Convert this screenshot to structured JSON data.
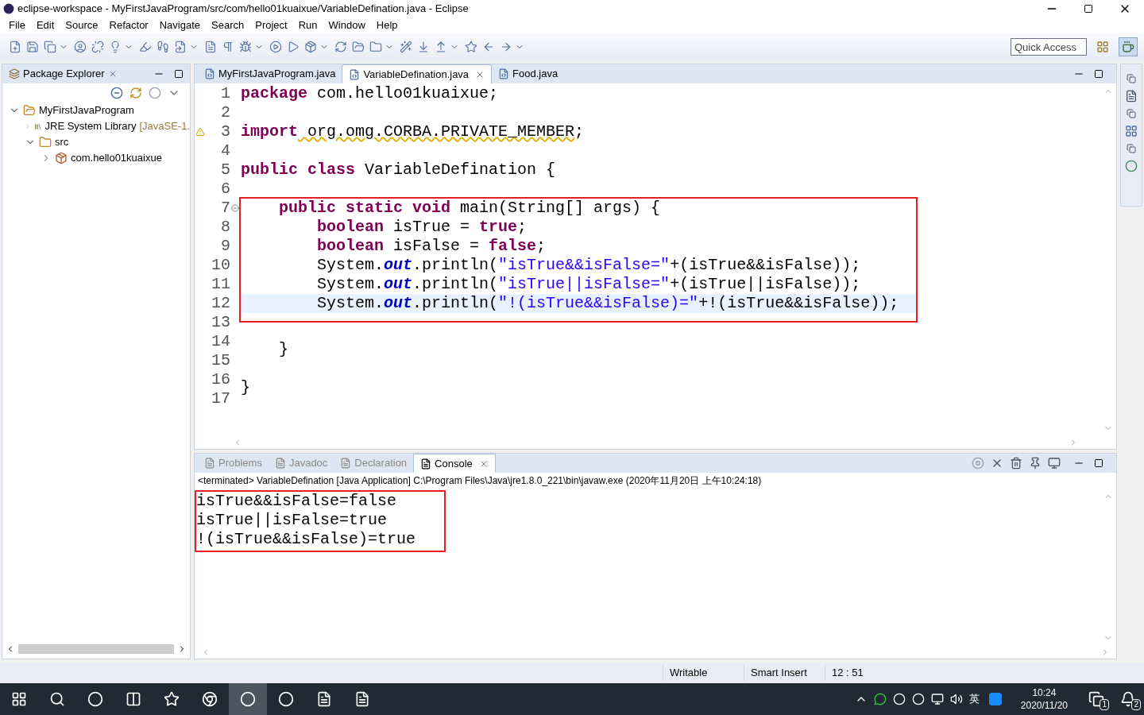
{
  "window": {
    "title": "eclipse-workspace - MyFirstJavaProgram/src/com/hello01kuaixue/VariableDefination.java - Eclipse"
  },
  "menu": [
    "File",
    "Edit",
    "Source",
    "Refactor",
    "Navigate",
    "Search",
    "Project",
    "Run",
    "Window",
    "Help"
  ],
  "quick_access": {
    "placeholder": "Quick Access"
  },
  "package_explorer": {
    "title": "Package Explorer",
    "tree": [
      {
        "label": "MyFirstJavaProgram",
        "kind": "project",
        "expanded": true,
        "children": [
          {
            "label": "JRE System Library",
            "suffix": "[JavaSE-1.",
            "kind": "library",
            "expanded": false
          },
          {
            "label": "src",
            "kind": "folder",
            "expanded": true,
            "children": [
              {
                "label": "com.hello01kuaixue",
                "kind": "package",
                "expanded": false
              }
            ]
          }
        ]
      }
    ]
  },
  "editor_tabs": [
    {
      "label": "MyFirstJavaProgram.java",
      "selected": false
    },
    {
      "label": "VariableDefination.java",
      "selected": true,
      "closable": true
    },
    {
      "label": "Food.java",
      "selected": false
    }
  ],
  "editor": {
    "blocks": [
      {
        "lines": [
          {
            "number": "1",
            "kind": "plain",
            "tokens": [
              {
                "kind": "kw",
                "text": "package"
              },
              {
                "kind": "text",
                "text": " com.hello01kuaixue;"
              }
            ]
          },
          {
            "number": "2",
            "kind": "plain"
          },
          {
            "number": "3",
            "kind": "warning",
            "tokens": [
              {
                "kind": "kw",
                "text": "import"
              },
              {
                "kind": "warn",
                "text": " org.omg.CORBA.PRIVATE_MEMBER"
              },
              {
                "kind": "text",
                "text": ";"
              }
            ]
          },
          {
            "number": "4",
            "kind": "plain"
          },
          {
            "number": "5",
            "kind": "plain",
            "tokens": [
              {
                "kind": "kw",
                "text": "public class"
              },
              {
                "kind": "text",
                "text": " VariableDefination {"
              }
            ]
          },
          {
            "number": "6",
            "kind": "plain"
          }
        ]
      },
      {
        "boxed": true,
        "lines": [
          {
            "number": "7",
            "kind": "fold",
            "tokens": [
              {
                "kind": "kw",
                "text": "    public static void"
              },
              {
                "kind": "text",
                "text": " main(String[] args) {"
              }
            ]
          },
          {
            "number": "8",
            "kind": "plain",
            "tokens": [
              {
                "kind": "kw",
                "text": "        boolean"
              },
              {
                "kind": "text",
                "text": " isTrue = "
              },
              {
                "kind": "kw",
                "text": "true"
              },
              {
                "kind": "text",
                "text": ";"
              }
            ]
          },
          {
            "number": "9",
            "kind": "plain",
            "tokens": [
              {
                "kind": "kw",
                "text": "        boolean"
              },
              {
                "kind": "text",
                "text": " isFalse = "
              },
              {
                "kind": "kw",
                "text": "false"
              },
              {
                "kind": "text",
                "text": ";"
              }
            ]
          },
          {
            "number": "10",
            "kind": "plain",
            "tokens": [
              {
                "kind": "text",
                "text": "        System."
              },
              {
                "kind": "field",
                "text": "out"
              },
              {
                "kind": "text",
                "text": ".println("
              },
              {
                "kind": "str",
                "text": "\"isTrue&&isFalse=\""
              },
              {
                "kind": "text",
                "text": "+(isTrue&&isFalse));"
              }
            ]
          },
          {
            "number": "11",
            "kind": "plain",
            "tokens": [
              {
                "kind": "text",
                "text": "        System."
              },
              {
                "kind": "field",
                "text": "out"
              },
              {
                "kind": "text",
                "text": ".println("
              },
              {
                "kind": "str",
                "text": "\"isTrue||isFalse=\""
              },
              {
                "kind": "text",
                "text": "+(isTrue||isFalse));"
              }
            ]
          },
          {
            "number": "12",
            "kind": "plain",
            "current": true,
            "tokens": [
              {
                "kind": "text",
                "text": "        System."
              },
              {
                "kind": "field",
                "text": "out"
              },
              {
                "kind": "text",
                "text": ".println("
              },
              {
                "kind": "str",
                "text": "\"!(isTrue&&isFalse)=\""
              },
              {
                "kind": "text",
                "text": "+!(isTrue&&isFalse));"
              }
            ]
          }
        ]
      },
      {
        "lines": [
          {
            "number": "13",
            "kind": "plain"
          },
          {
            "number": "14",
            "kind": "plain",
            "tokens": [
              {
                "kind": "text",
                "text": "    }"
              }
            ]
          },
          {
            "number": "15",
            "kind": "plain"
          },
          {
            "number": "16",
            "kind": "plain",
            "tokens": [
              {
                "kind": "text",
                "text": "}"
              }
            ]
          },
          {
            "number": "17",
            "kind": "plain"
          }
        ]
      }
    ]
  },
  "console_tabs": [
    {
      "label": "Problems",
      "selected": false
    },
    {
      "label": "Javadoc",
      "selected": false
    },
    {
      "label": "Declaration",
      "selected": false
    },
    {
      "label": "Console",
      "selected": true
    }
  ],
  "console": {
    "header": "<terminated> VariableDefination [Java Application] C:\\Program Files\\Java\\jre1.8.0_221\\bin\\javaw.exe (2020年11月20日 上午10:24:18)",
    "boxed": true,
    "output": [
      "isTrue&&isFalse=false",
      "isTrue||isFalse=true",
      "!(isTrue&&isFalse)=true"
    ]
  },
  "status_bar": [
    "Writable",
    "Smart Insert",
    "12 : 51"
  ],
  "taskbar": {
    "ime": "英",
    "time": "10:24",
    "date": "2020/11/20",
    "badges": [
      "1",
      "2"
    ]
  }
}
